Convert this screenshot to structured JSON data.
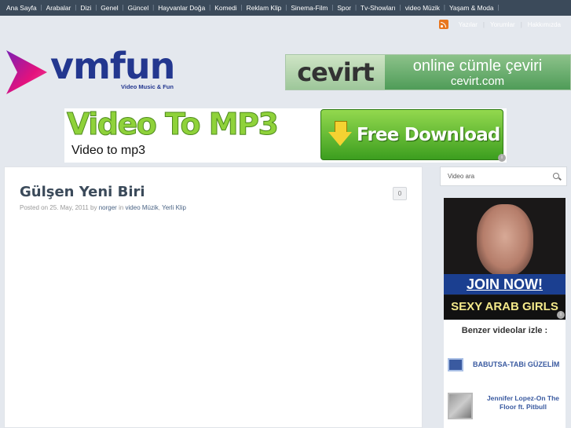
{
  "nav": {
    "items": [
      "Ana Sayfa",
      "Arabalar",
      "Dizi",
      "Genel",
      "Güncel",
      "Hayvanlar Doğa",
      "Komedi",
      "Reklam Klip",
      "Sinema-Film",
      "Spor",
      "Tv-Showları",
      "video Müzik",
      "Yaşam & Moda"
    ]
  },
  "subbar": {
    "yazilar": "Yazılar",
    "yorumlar": "Yorumlar",
    "hakkimizda": "Hakkımızda"
  },
  "logo": {
    "text": "vmfun",
    "tagline": "Video Music & Fun"
  },
  "cevirt_ad": {
    "brand": "cevirt",
    "slogan": "online cümle çeviri",
    "url": "cevirt.com"
  },
  "mp3_ad": {
    "title": "Video To MP3",
    "subtitle": "Video to mp3",
    "button": "Free Download",
    "info": "i"
  },
  "post": {
    "title": "Gülşen Yeni Biri",
    "posted_on": "Posted on",
    "date": "25. May, 2011",
    "by": "by",
    "author": "norger",
    "in": "in",
    "category1": "video Müzik",
    "category2": "Yerli Klip",
    "comments": "0"
  },
  "sidebar": {
    "search_placeholder": "Video ara",
    "ad_join": "JOIN NOW!",
    "ad_sexy": "SEXY ARAB GIRLS",
    "related_title": "Benzer videolar izle :",
    "related": [
      "BABUTSA-TABi GÜZELİM",
      "Jennifer Lopez-On The Floor ft. Pitbull"
    ]
  },
  "colors": {
    "nav_bg": "#3b4a5a",
    "logo_blue": "#23378f",
    "logo_arrow": "#e4127d",
    "link": "#3a5aa0"
  }
}
